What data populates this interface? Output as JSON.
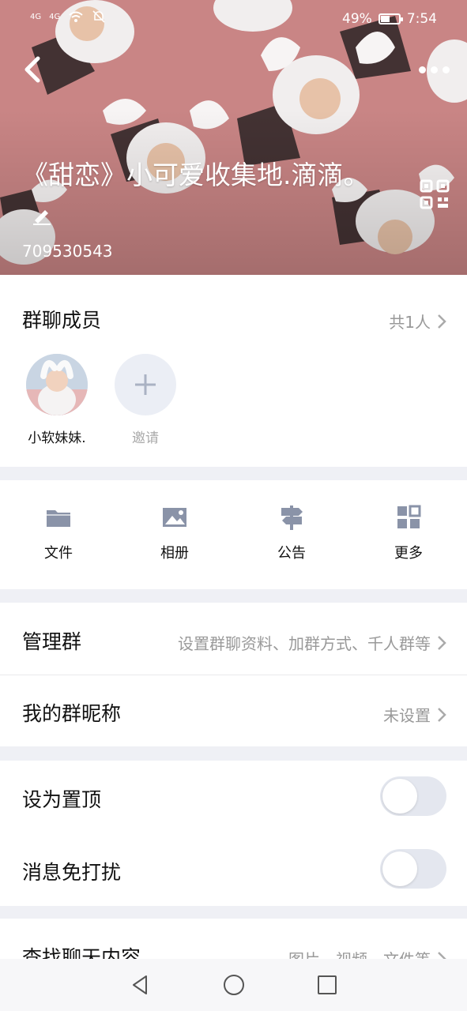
{
  "status_bar": {
    "signal1": "4G",
    "signal2": "4G",
    "battery_percent": "49%",
    "battery_level": 0.49,
    "time": "7:54"
  },
  "header": {
    "title": "《甜恋》小可爱收集地.滴滴。",
    "group_id": "709530543",
    "icons": {
      "back": "back-chevron-icon",
      "more": "more-dots-icon",
      "edit": "edit-pencil-icon",
      "qr": "qr-code-icon"
    }
  },
  "members": {
    "title": "群聊成员",
    "count": "共1人",
    "items": [
      {
        "label": "小软妹妹."
      },
      {
        "label": "邀请"
      }
    ]
  },
  "tools": [
    {
      "label": "文件",
      "icon": "folder-icon"
    },
    {
      "label": "相册",
      "icon": "image-icon"
    },
    {
      "label": "公告",
      "icon": "signpost-icon"
    },
    {
      "label": "更多",
      "icon": "grid-icon"
    }
  ],
  "settings": {
    "manage": {
      "label": "管理群",
      "value": "设置群聊资料、加群方式、千人群等"
    },
    "nickname": {
      "label": "我的群昵称",
      "value": "未设置"
    },
    "pin": {
      "label": "设为置顶",
      "on": false
    },
    "mute": {
      "label": "消息免打扰",
      "on": false
    },
    "search": {
      "label": "查找聊天内容",
      "value": "图片、视频、文件等"
    }
  },
  "colors": {
    "banner": "#c98585",
    "page_bg": "#eff0f5",
    "accent_icon": "#8a93a8"
  }
}
